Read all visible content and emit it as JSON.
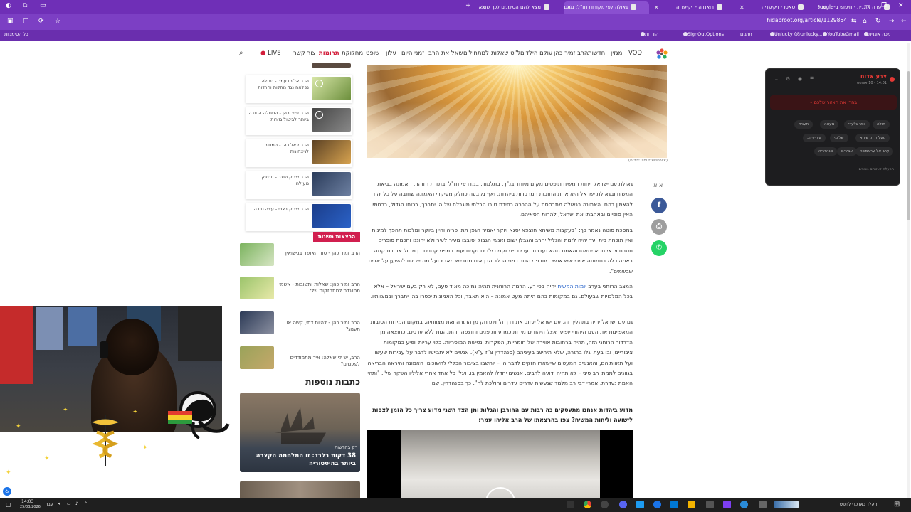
{
  "browser": {
    "tabs": [
      {
        "label": "פרה אוגנית - חיפוש ב-Google",
        "active": false
      },
      {
        "label": "טאטו - ויקיפדיה",
        "active": false
      },
      {
        "label": "רואנדה - ויקיפדיה",
        "active": false
      },
      {
        "label": "גאולה לפי מקורות חז\"ל: מהם...",
        "active": true
      },
      {
        "label": "מצא להם הסימנים לכך שהיא...",
        "active": false
      }
    ],
    "url": "hidabroot.org/article/1129854",
    "bookmarks": [
      "מכה אוגנית",
      "Gmail",
      "YouTube",
      "Unlucky (@unlucky...",
      "תרגום",
      "SignOutOptions",
      "הורדות"
    ],
    "bookmarks_left": "כל הסימניות"
  },
  "site_nav": {
    "items": [
      "VOD",
      "מגזין",
      "חדשות",
      "הרב זמיר כהן",
      "עולם הילדים",
      "ל\"ט שאלות",
      "למתחילים",
      "שאל את הרב",
      "זמני היום",
      "עלון",
      "שופט",
      "מחלוקת",
      "תרומות",
      "צור קשר",
      "LIVE"
    ],
    "donate_label": "תרומות"
  },
  "sidebar": {
    "videos": [
      {
        "title": "הרב אליהו עמר - סגולה נפלאה נגד מחלות וחרדות"
      },
      {
        "title": "הרב זמיר כהן - הסגולה הטובה ביותר לביטול גזירות"
      },
      {
        "title": "הרב יגאל כהן - המחיר לניצחונות"
      },
      {
        "title": "הרב יצחק פנגר - תחזוק מעולה"
      },
      {
        "title": "הרב יצחק בצרי - עצה טובה"
      }
    ],
    "lectures_badge": "הרצאות משנות חיים",
    "lectures": [
      {
        "title": "הרב זמיר כהן - סוד האושר בנישואין"
      },
      {
        "title": "הרב זמיר כהן: שאלות ותשובות - אשמי מתנגדת למתחזקות של?"
      },
      {
        "title": "הרב זמיר כהן - להיות דתי, קשה או תענוג?"
      },
      {
        "title": "הרב, יש לי שאלה: איך מתמודדים לפעמים?"
      }
    ],
    "more_heading": "כתבות נוספות",
    "big_card": {
      "tag": "רק בחדשות",
      "title": "38 דקות בלבד: זו המלחמה הקצרה ביותר בהיסטוריה"
    }
  },
  "article": {
    "image_credit": "(צילום: shutterstock)",
    "font_size_icon": "א א",
    "paragraphs": [
      "גאולת עם ישראל ויחות המשיח תופסים מקום מיוחד בנ\"ך, בתלמוד, במדרשי חז\"ל ובתורת הזוהר. האמונה בביאת המשיח ובגאולת ישראל היא אחת החובות המרכזיות ביהדות, ואף נקבעה כחלק מעיקרי האמונה שחובה על כל יהודי להאמין בהם. האמונה בגאולה מתבססת על ההכרה בחידת טובו הבלתי מוגבלת של ה' יתברך, בכוחו הגדול, ברחמיו האין סופיים ובאהבתו את ישראל, להרות חסאיהם.",
      "במסכת סוטה נאמר כך: \"בעקבות משיחא חוצפא יסגא ויוקר יאמיר הגפן תתן פריה והיין ביוקר ומלכות תהפך למינות ואין תוכחת בית ועד יהיה לזנות והגליל יחרב והגבלן ישום ואנשי הגבול יסובבו מעיר לעיר ולא יחוננו וחכמת סופרים תסרח ויראי חטא ימאסו והאמת תהא נעדרת נערים פני זקנים ילבינו זקנים יעמדו מפני קטנים בן מנוול אב בת קמה באמה כלה בחמותה אויבי איש אנשי ביתו פני הדור כפני הכלב הבן אינו מתבייש מאביו ועל מה יש לנו להשען על אבינו שבשמים\".",
      "המצב הרוחני בערב יומות המשיח יהיה בכי רע. הרמה הרוחנית תהיה נמוכה מאוד פעם, לא רק בעם ישראל – אלא בכל המלכויות שבעולם. גם במקומות בהם היתה מעט אמונה – היא תאבד, וכל האמונות יכפרו בה' יתברך ובמצוותיו.",
      "גם עם ישראל יהיה בתהליך זה, עם ישראל יעזוב את דרך ה' ויתרחק מן התורה ואת מצוותיה. במקום המידות הטובות המאפיינות את העם היהודי יופיעו אצל היהודים מידות כמו עזות פנים וחוצפה, והתנהגות ללא ערכים. כתוצאה מן הדרדור הרוחני הזה, תהיה ברחובות אווירה של חומריות, הפקרות ונטישת המוסריות. כלוי עריות יופיע במקומות ציבוריים, ובו בעת יגלו בתורה, שלא תיחשב בעיניהם (סנהדרין צ\"ז ע\"א). אנשים לא יתביישו לדבר על עבירות שעשו ועל תאוותיהם, והאנשים המעטים שיישארו חזקים לדבר ה' – יוחשבו בציבור הכללי לחשוכים. האמונה והיראה הבריאה בגוונים לממתי רב סיני – לא תהיה ידועה לרבים. אנשים יחדלו להאמין בו, ויגלו כל אחד אחרי אליליו השקר שלו. \"ותהי האמת נעדרת, אמרי דבי רב מלמד שנעשית עדרים עדרים והולכת לה\". כך בסנהדרין, שם.",
      "מדוע ביהדות אנחנו מתעסקים כה רבות עם החורבן והגלות ומן הצד השני מדוע צריך כל הזמן לצפות לישועה וליחות המשיח? צפו בהרצאתו של הרב אליהו עמר:"
    ],
    "link_text": "יומות המשיח"
  },
  "popup": {
    "title": "צבע אדום",
    "subtitle": "14:01 - 10 אוגוסט",
    "button": "בחרו את האזור שלכם",
    "chips": [
      "חולה",
      "כפר גלעדי",
      "מעונה",
      "תענית",
      "מעלות תרשיחא",
      "שלומי",
      "עין יעקב",
      "ערב אל עראמשה",
      "שומרה",
      "אבירים",
      "עין בשן",
      "ערב אל נעים",
      "שתולה",
      "סנהדריה",
      "סקוולה"
    ],
    "footer": "הפעלה לאזורים נוספים"
  },
  "taskbar": {
    "search_placeholder": "הקלד כאן כדי לחפש",
    "time": "14:03",
    "date": "25/03/2026",
    "lang": "עבר"
  },
  "colors": {
    "browser_purple": "#6f2fb7",
    "accent_red": "#d21d3a",
    "facebook": "#3b5998",
    "whatsapp": "#25d366",
    "print": "#9e9e9e"
  }
}
